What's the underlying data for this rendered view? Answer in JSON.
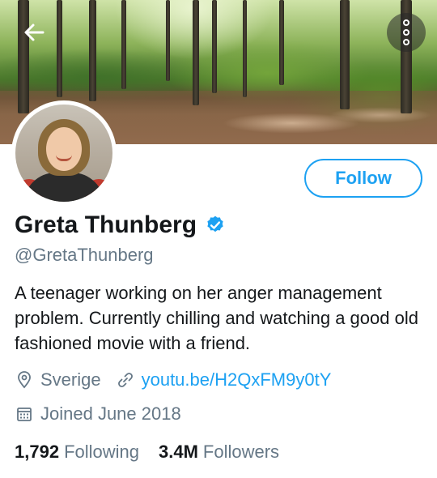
{
  "header": {
    "back_icon": "arrow-left-icon",
    "more_icon": "more-vertical-icon"
  },
  "profile": {
    "name": "Greta Thunberg",
    "verified_icon": "verified-badge-icon",
    "handle": "@GretaThunberg",
    "bio": "A teenager working on her anger management problem. Currently chilling and watching a good old fashioned movie with a friend.",
    "location": "Sverige",
    "location_icon": "location-pin-icon",
    "url": "youtu.be/H2QxFM9y0tY",
    "url_icon": "link-icon",
    "joined": "Joined June 2018",
    "joined_icon": "calendar-icon",
    "follow_label": "Follow"
  },
  "stats": {
    "following_count": "1,792",
    "following_label": "Following",
    "followers_count": "3.4M",
    "followers_label": "Followers"
  },
  "colors": {
    "accent": "#1da1f2",
    "muted": "#657786",
    "text": "#14171a"
  }
}
